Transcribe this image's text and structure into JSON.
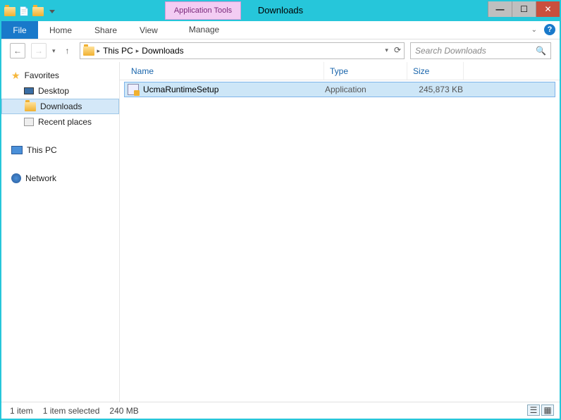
{
  "titlebar": {
    "context_tab": "Application Tools",
    "window_title": "Downloads"
  },
  "ribbon": {
    "file": "File",
    "tabs": [
      "Home",
      "Share",
      "View"
    ],
    "context_tabs": [
      "Manage"
    ]
  },
  "breadcrumb": {
    "segments": [
      "This PC",
      "Downloads"
    ]
  },
  "search": {
    "placeholder": "Search Downloads"
  },
  "nav": {
    "favorites": {
      "label": "Favorites",
      "items": [
        "Desktop",
        "Downloads",
        "Recent places"
      ],
      "selected": "Downloads"
    },
    "this_pc": "This PC",
    "network": "Network"
  },
  "columns": {
    "name": "Name",
    "type": "Type",
    "size": "Size"
  },
  "files": [
    {
      "name": "UcmaRuntimeSetup",
      "type": "Application",
      "size": "245,873 KB"
    }
  ],
  "status": {
    "count": "1 item",
    "selection": "1 item selected",
    "sel_size": "240 MB"
  }
}
